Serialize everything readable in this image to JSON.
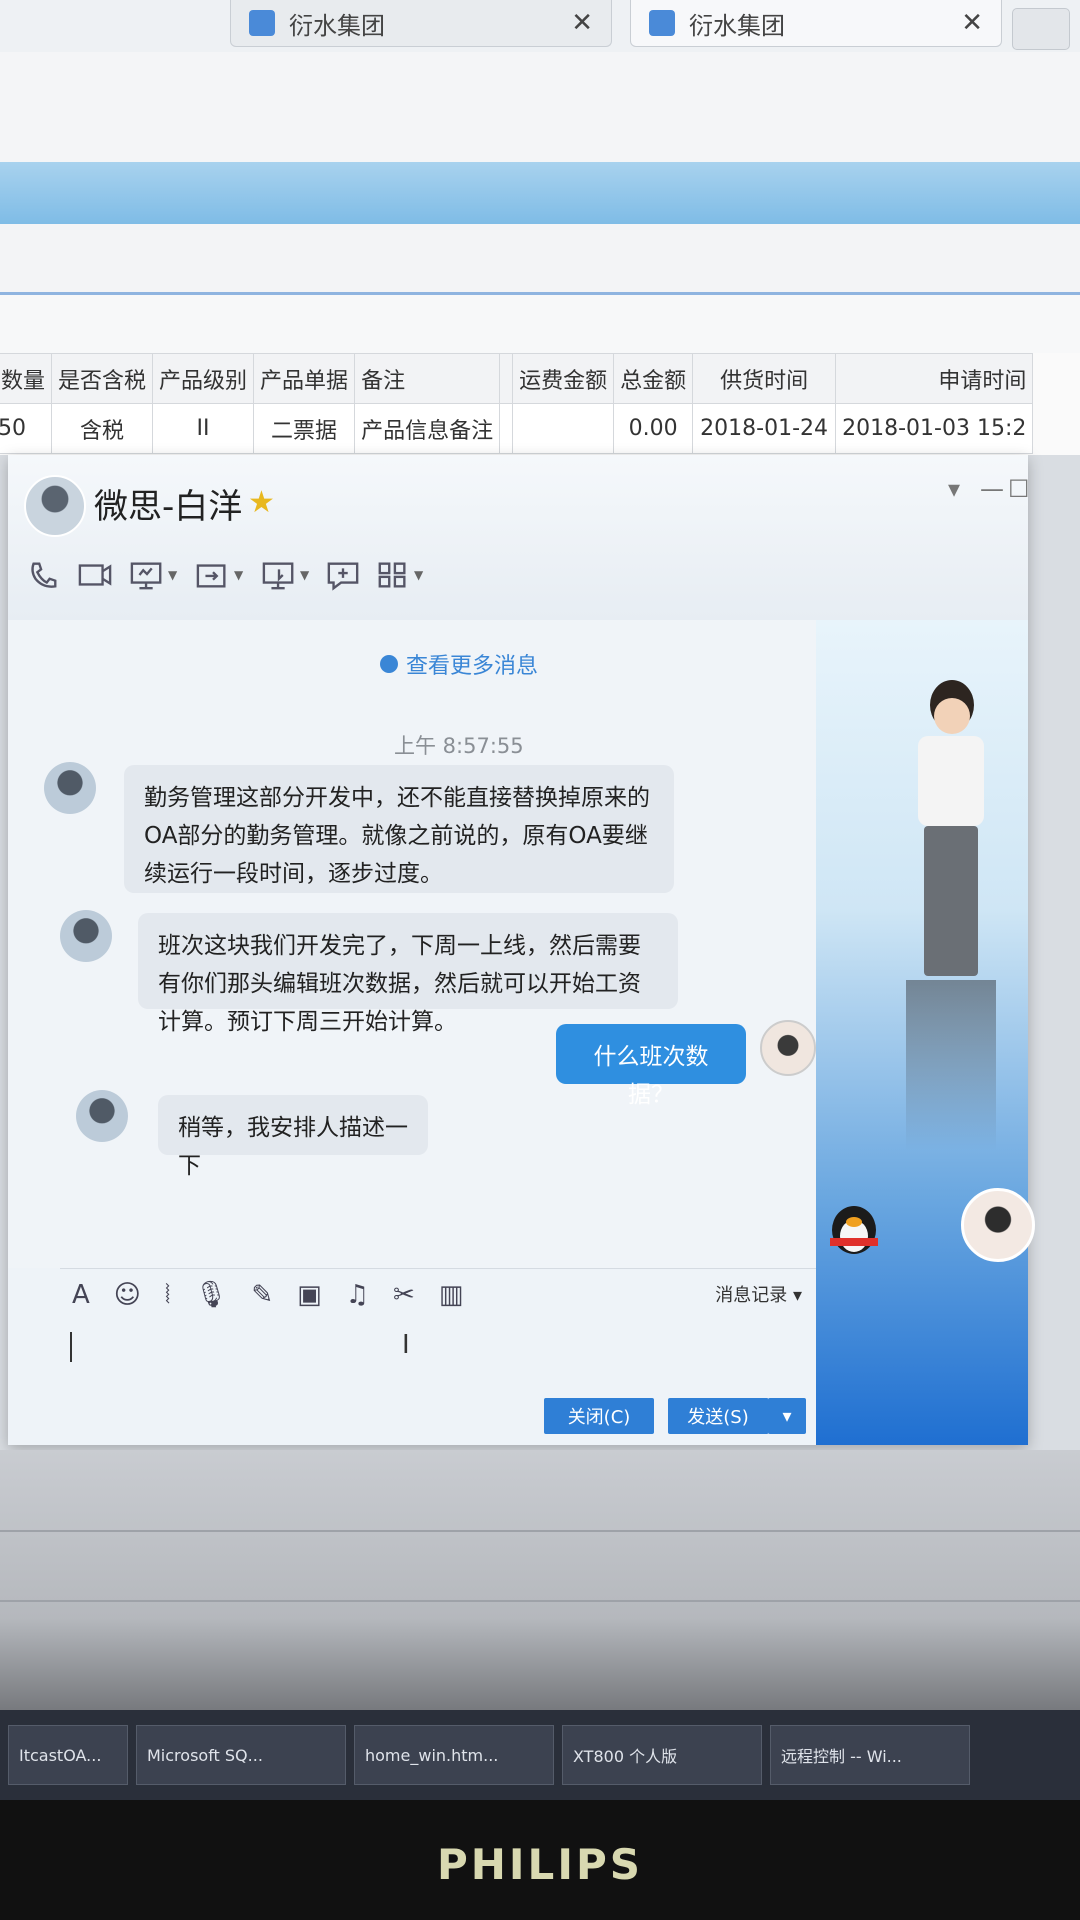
{
  "browser": {
    "tabs": [
      {
        "label": "衍水集团"
      },
      {
        "label": "衍水集团"
      }
    ]
  },
  "table": {
    "headers": [
      "品数量",
      "是否含税",
      "产品级别",
      "产品单据",
      "备注",
      "",
      "运费金额",
      "总金额",
      "供货时间",
      "申请时间"
    ],
    "rows": [
      [
        "50",
        "含税",
        "II",
        "二票据",
        "产品信息备注",
        "",
        "",
        "0.00",
        "2018-01-24",
        "2018-01-03 15:2"
      ]
    ]
  },
  "chat": {
    "contact_name": "微思-白洋",
    "load_more": "查看更多消息",
    "timestamp": "上午 8:57:55",
    "messages": [
      {
        "from": "other",
        "text": "勤务管理这部分开发中，还不能直接替换掉原来的OA部分的勤务管理。就像之前说的，原有OA要继续运行一段时间，逐步过度。"
      },
      {
        "from": "other",
        "text": "班次这块我们开发完了，下周一上线，然后需要有你们那头编辑班次数据，然后就可以开始工资计算。预订下周三开始计算。"
      },
      {
        "from": "me",
        "text": "什么班次数据？"
      },
      {
        "from": "other",
        "text": "稍等，我安排人描述一下"
      }
    ],
    "history_label": "消息记录",
    "close_button": "关闭(C)",
    "send_button": "发送(S)"
  },
  "taskbar": {
    "items": [
      {
        "label": "ItcastOA..."
      },
      {
        "label": "Microsoft SQ..."
      },
      {
        "label": "home_win.htm..."
      },
      {
        "label": "XT800 个人版"
      },
      {
        "label": "远程控制 -- Wi..."
      }
    ]
  },
  "monitor": {
    "brand": "PHILIPS"
  },
  "colors": {
    "accent": "#2f8fe0",
    "send_button": "#2f7fd6",
    "bubble_other": "#e3e8ee"
  }
}
